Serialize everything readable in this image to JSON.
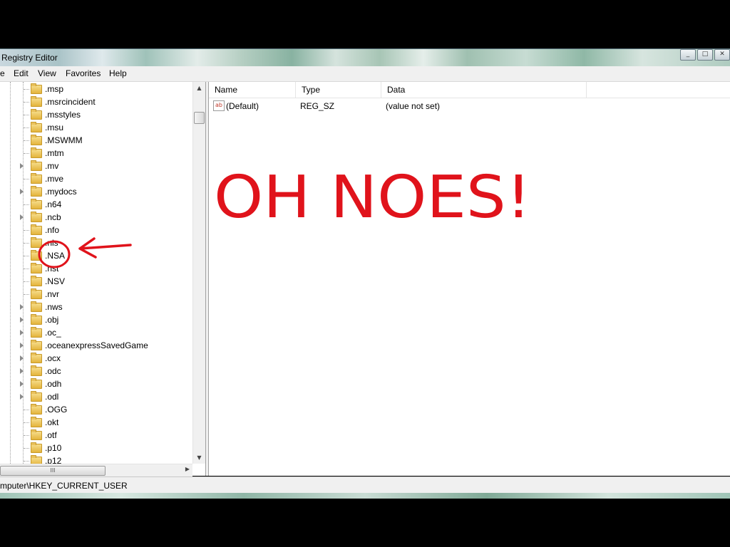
{
  "window": {
    "title": "Registry Editor",
    "buttons": {
      "minimize": "_",
      "maximize": "□",
      "close": "✕"
    }
  },
  "menu": {
    "items": [
      "e",
      "Edit",
      "View",
      "Favorites",
      "Help"
    ]
  },
  "tree": {
    "items": [
      {
        "label": ".msp",
        "expandable": false
      },
      {
        "label": ".msrcincident",
        "expandable": false
      },
      {
        "label": ".msstyles",
        "expandable": false
      },
      {
        "label": ".msu",
        "expandable": false
      },
      {
        "label": ".MSWMM",
        "expandable": false
      },
      {
        "label": ".mtm",
        "expandable": false
      },
      {
        "label": ".mv",
        "expandable": true
      },
      {
        "label": ".mve",
        "expandable": false
      },
      {
        "label": ".mydocs",
        "expandable": true
      },
      {
        "label": ".n64",
        "expandable": false
      },
      {
        "label": ".ncb",
        "expandable": true
      },
      {
        "label": ".nfo",
        "expandable": false
      },
      {
        "label": ".nls",
        "expandable": false
      },
      {
        "label": ".NSA",
        "expandable": false
      },
      {
        "label": ".nst",
        "expandable": false
      },
      {
        "label": ".NSV",
        "expandable": false
      },
      {
        "label": ".nvr",
        "expandable": false
      },
      {
        "label": ".nws",
        "expandable": true
      },
      {
        "label": ".obj",
        "expandable": true
      },
      {
        "label": ".oc_",
        "expandable": true
      },
      {
        "label": ".oceanexpressSavedGame",
        "expandable": true
      },
      {
        "label": ".ocx",
        "expandable": true
      },
      {
        "label": ".odc",
        "expandable": true
      },
      {
        "label": ".odh",
        "expandable": true
      },
      {
        "label": ".odl",
        "expandable": true
      },
      {
        "label": ".OGG",
        "expandable": false
      },
      {
        "label": ".okt",
        "expandable": false
      },
      {
        "label": ".otf",
        "expandable": false
      },
      {
        "label": ".p10",
        "expandable": false
      },
      {
        "label": ".p12",
        "expandable": false
      }
    ],
    "hscroll_grip": "III"
  },
  "list": {
    "columns": [
      "Name",
      "Type",
      "Data"
    ],
    "rows": [
      {
        "icon": "ab",
        "name": "(Default)",
        "type": "REG_SZ",
        "data": "(value not set)"
      }
    ]
  },
  "status": {
    "path": "mputer\\HKEY_CURRENT_USER"
  },
  "annotation": {
    "text": "OH NOES!",
    "color": "#e0131b"
  }
}
